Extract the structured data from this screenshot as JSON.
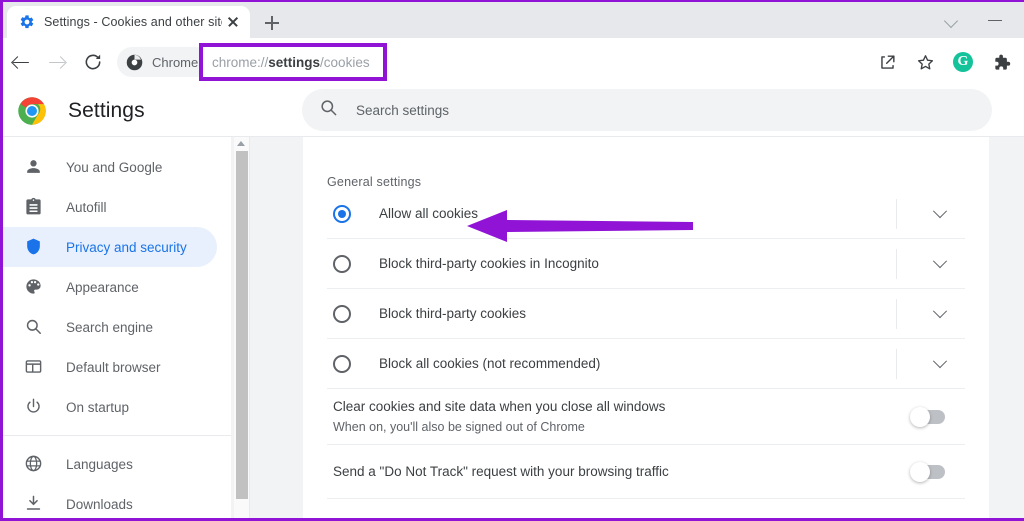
{
  "window": {
    "controls": [
      {
        "name": "chevron-down-icon",
        "label": ""
      },
      {
        "name": "minimize-icon",
        "label": ""
      }
    ]
  },
  "tabstrip": {
    "tab_title": "Settings - Cookies and other site",
    "favicon": "gear-icon",
    "close_label": "",
    "new_tab_label": ""
  },
  "toolbar": {
    "back_label": "",
    "forward_label": "",
    "reload_label": "",
    "chrome_chip_label": "Chrome",
    "url_prefix": "chrome://",
    "url_bold": "settings",
    "url_suffix": "/cookies",
    "url_full": "chrome://settings/cookies",
    "highlight_color": "#9013d6",
    "right_icons": [
      {
        "name": "share-icon",
        "label": ""
      },
      {
        "name": "bookmark-star-icon",
        "label": ""
      },
      {
        "name": "grammarly-extension-icon",
        "label": "G"
      },
      {
        "name": "extensions-puzzle-icon",
        "label": ""
      }
    ]
  },
  "settings_header": {
    "title": "Settings",
    "logo": "chrome-logo"
  },
  "search": {
    "placeholder": "Search settings",
    "icon": "search-icon"
  },
  "sidebar": {
    "items": [
      {
        "label": "You and Google",
        "icon": "person-icon",
        "active": false
      },
      {
        "label": "Autofill",
        "icon": "clipboard-icon",
        "active": false
      },
      {
        "label": "Privacy and security",
        "icon": "shield-icon",
        "active": true
      },
      {
        "label": "Appearance",
        "icon": "palette-icon",
        "active": false
      },
      {
        "label": "Search engine",
        "icon": "magnifier-icon",
        "active": false
      },
      {
        "label": "Default browser",
        "icon": "browser-window-icon",
        "active": false
      },
      {
        "label": "On startup",
        "icon": "power-icon",
        "active": false
      }
    ],
    "items_after_divider": [
      {
        "label": "Languages",
        "icon": "globe-icon",
        "active": false
      },
      {
        "label": "Downloads",
        "icon": "download-icon",
        "active": false
      }
    ],
    "active_color": "#1a73e8",
    "active_bg": "#e8f0fe"
  },
  "content": {
    "section_title": "General settings",
    "cookie_options": [
      {
        "label": "Allow all cookies",
        "selected": true
      },
      {
        "label": "Block third-party cookies in Incognito",
        "selected": false
      },
      {
        "label": "Block third-party cookies",
        "selected": false
      },
      {
        "label": "Block all cookies (not recommended)",
        "selected": false
      }
    ],
    "toggles": [
      {
        "title": "Clear cookies and site data when you close all windows",
        "subtitle": "When on, you'll also be signed out of Chrome",
        "on": false
      },
      {
        "title": "Send a \"Do Not Track\" request with your browsing traffic",
        "subtitle": "",
        "on": false
      }
    ]
  },
  "annotation": {
    "arrow_color": "#9013d6",
    "points_at": "Allow all cookies"
  }
}
